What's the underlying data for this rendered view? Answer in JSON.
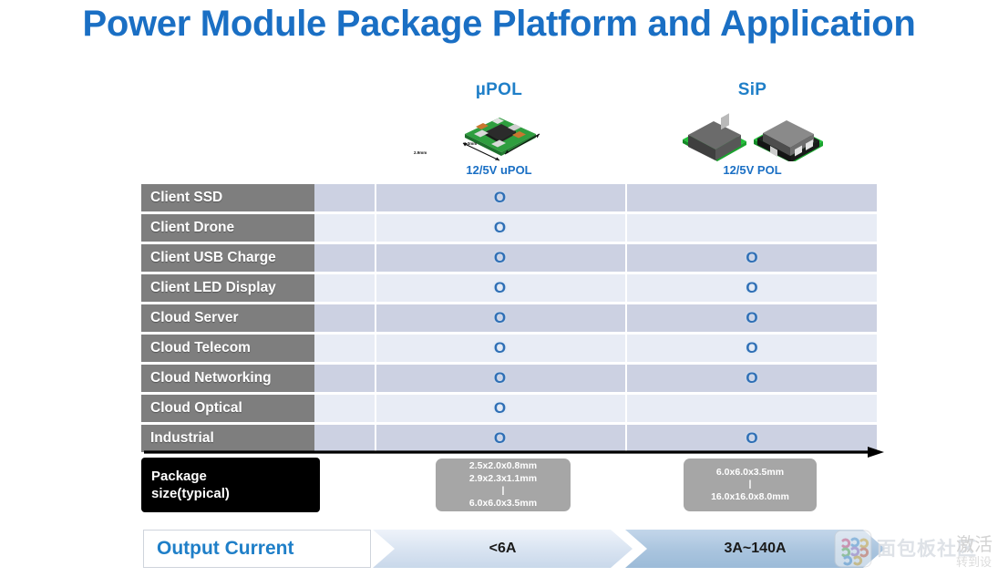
{
  "slide": {
    "title": "Power Module Package Platform and Application",
    "title_color": "#1a6fc4"
  },
  "columns": [
    {
      "caption": "µPOL",
      "subcaption": "12/5V uPOL",
      "icon": "upol-module-photo",
      "dim_w": "2.9mm",
      "dim_h": "2.3mm"
    },
    {
      "caption": "SiP",
      "subcaption": "12/5V POL",
      "icon": "sip-module-photo"
    }
  ],
  "table": {
    "rows": [
      {
        "label": "Client SSD",
        "upol": "O",
        "sip": ""
      },
      {
        "label": "Client Drone",
        "upol": "O",
        "sip": ""
      },
      {
        "label": "Client USB Charge",
        "upol": "O",
        "sip": "O"
      },
      {
        "label": "Client LED Display",
        "upol": "O",
        "sip": "O"
      },
      {
        "label": "Cloud Server",
        "upol": "O",
        "sip": "O"
      },
      {
        "label": "Cloud Telecom",
        "upol": "O",
        "sip": "O"
      },
      {
        "label": "Cloud Networking",
        "upol": "O",
        "sip": "O"
      },
      {
        "label": "Cloud Optical",
        "upol": "O",
        "sip": ""
      },
      {
        "label": "Industrial",
        "upol": "O",
        "sip": "O"
      }
    ]
  },
  "package_size": {
    "label_line1": "Package",
    "label_line2": "size(typical)",
    "upol": {
      "line1": "2.5x2.0x0.8mm",
      "line2": "2.9x2.3x1.1mm",
      "divider": "|",
      "line3": "6.0x6.0x3.5mm"
    },
    "sip": {
      "line1": "6.0x6.0x3.5mm",
      "divider": "|",
      "line2": "16.0x16.0x8.0mm"
    }
  },
  "output_current": {
    "label": "Output Current",
    "upol_value": "<6A",
    "sip_value": "3A~140A"
  },
  "watermark": {
    "site_text": "面包板社区",
    "activate_line1": "激活",
    "activate_line2": "转到设"
  }
}
